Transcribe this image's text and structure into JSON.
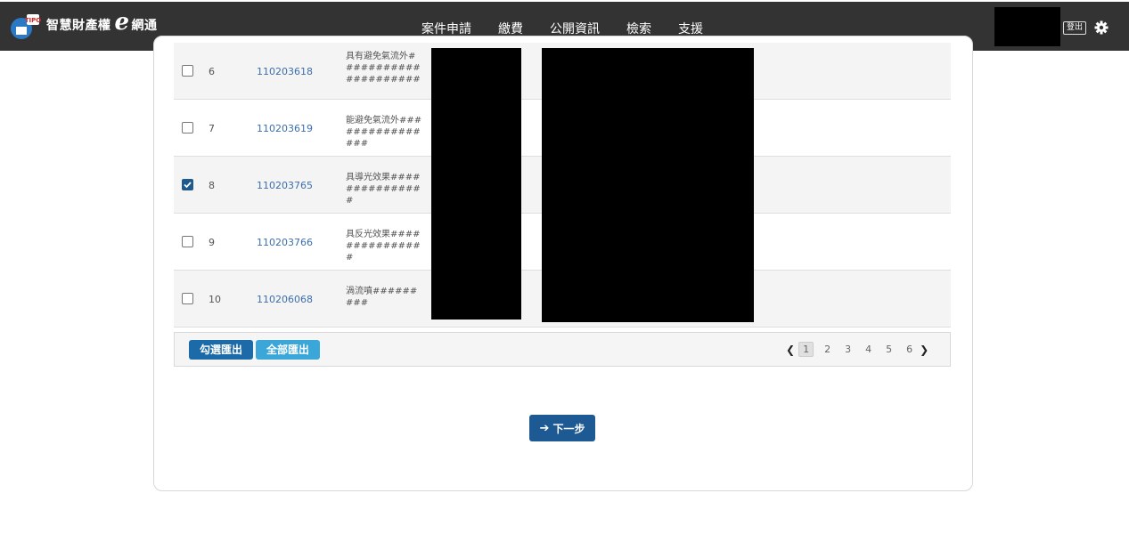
{
  "header": {
    "brand_prefix": "智慧財產權",
    "brand_e": "e",
    "brand_suffix": "網通",
    "logo_text": "TIPO",
    "nav": [
      "案件申請",
      "繳費",
      "公開資訊",
      "檢索",
      "支援"
    ],
    "logout_label": "登出"
  },
  "table": {
    "rows": [
      {
        "num": "6",
        "appno": "110203618",
        "title": "具有避免氣流外#####################",
        "checked": false
      },
      {
        "num": "7",
        "appno": "110203619",
        "title": "能避免氣流外################",
        "checked": false
      },
      {
        "num": "8",
        "appno": "110203765",
        "title": "具導光效果###############",
        "checked": true
      },
      {
        "num": "9",
        "appno": "110203766",
        "title": "具反光效果###############",
        "checked": false
      },
      {
        "num": "10",
        "appno": "110206068",
        "title": "渦流噴#########",
        "checked": false
      }
    ]
  },
  "footer": {
    "export_selected_label": "勾選匯出",
    "export_all_label": "全部匯出",
    "pages": [
      "1",
      "2",
      "3",
      "4",
      "5",
      "6"
    ],
    "current_page": "1"
  },
  "next_button_label": "下一步",
  "colors": {
    "navbar": "#333333",
    "primary": "#1d6aa8",
    "secondary": "#3ba7d8",
    "link": "#3d6fa8"
  }
}
